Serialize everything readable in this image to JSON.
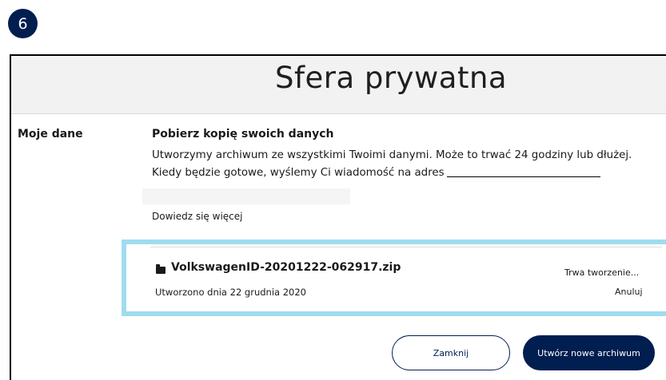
{
  "step": {
    "number": "6"
  },
  "page": {
    "title": "Sfera prywatna"
  },
  "section": {
    "label": "Moje dane",
    "heading": "Pobierz kopię swoich danych",
    "description": "Utworzymy archiwum ze wszystkimi Twoimi danymi. Może to trwać 24 godziny lub dłużej. Kiedy będzie gotowe, wyślemy Ci wiadomość na adres",
    "learn_more": "Dowiedz się więcej"
  },
  "archive": {
    "icon": "folder-icon",
    "file_name": "VolkswagenID-20201222-062917.zip",
    "created": "Utworzono dnia 22 grudnia 2020",
    "status": "Trwa tworzenie...",
    "cancel_label": "Anuluj"
  },
  "buttons": {
    "close_label": "Zamknij",
    "create_label": "Utwórz nowe archiwum"
  },
  "colors": {
    "brand_navy": "#001e50",
    "highlight": "#9fdcef",
    "title_bar": "#f2f2f2"
  }
}
